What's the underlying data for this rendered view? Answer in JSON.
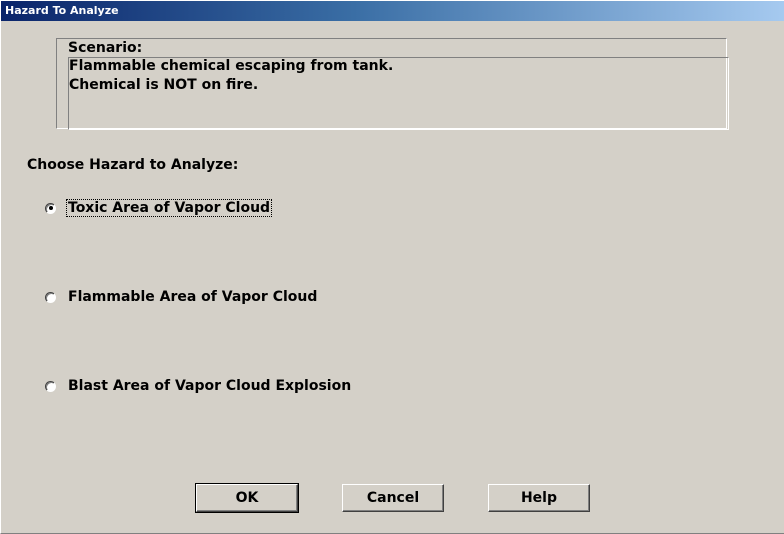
{
  "window": {
    "title": "Hazard To Analyze"
  },
  "scenario": {
    "lines": [
      "Scenario:",
      "Flammable chemical escaping from tank.",
      "Chemical is NOT on fire."
    ]
  },
  "hazard": {
    "prompt": "Choose Hazard to Analyze:",
    "options": [
      {
        "label": "Toxic Area of Vapor Cloud",
        "selected": true
      },
      {
        "label": "Flammable Area of Vapor Cloud",
        "selected": false
      },
      {
        "label": "Blast Area of Vapor Cloud Explosion",
        "selected": false
      }
    ]
  },
  "buttons": {
    "ok": "OK",
    "cancel": "Cancel",
    "help": "Help"
  },
  "colors": {
    "title_bar_start": "#0a246a",
    "title_bar_end": "#a6caf0",
    "dialog_face": "#d4d0c8"
  }
}
